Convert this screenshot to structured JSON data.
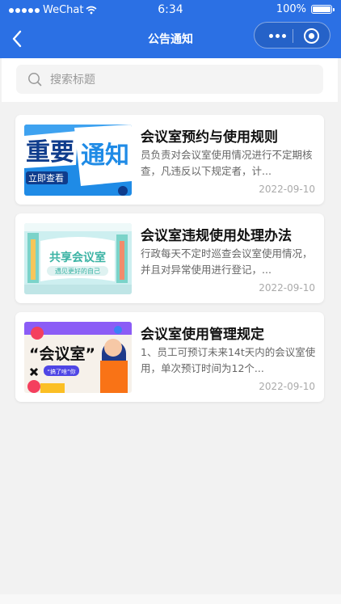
{
  "status_bar": {
    "carrier": "WeChat",
    "time": "6:34",
    "battery": "100%",
    "battery_level": 1.0
  },
  "nav": {
    "title": "公告通知",
    "back_icon": "chevron-left-icon",
    "more_icon": "more-dots-icon",
    "close_icon": "target-circle-icon"
  },
  "search": {
    "placeholder": "搜索标题",
    "value": "",
    "icon": "search-icon"
  },
  "colors": {
    "header_bg": "#2b70e4",
    "page_bg": "#f2f2f2",
    "card_bg": "#ffffff",
    "title_text": "#111111",
    "summary_text": "#666666",
    "date_text": "#aaaaaa"
  },
  "notices": [
    {
      "title": "会议室预约与使用规则",
      "summary": "员负责对会议室使用情况进行不定期核查，凡违反以下规定者，计...",
      "date": "2022-09-10",
      "thumb": {
        "line1": "重要",
        "line2": "通知",
        "tag": "立即查看"
      }
    },
    {
      "title": "会议室违规使用处理办法",
      "summary": "行政每天不定时巡查会议室使用情况，并且对异常使用进行登记，...",
      "date": "2022-09-10",
      "thumb": {
        "line1": "共享会议室",
        "line2": "遇见更好的自己"
      }
    },
    {
      "title": "会议室使用管理规定",
      "summary": "1、员工可预订未来14t天内的会议室使用，单次预订时间为12个...",
      "date": "2022-09-10",
      "thumb": {
        "line1": "“会议室”",
        "tag": "“搞了啥”你"
      }
    }
  ]
}
